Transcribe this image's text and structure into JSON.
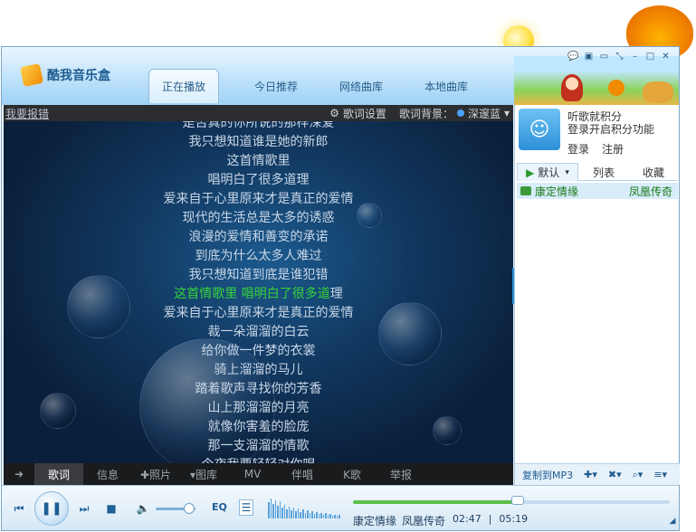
{
  "app": {
    "title": "酷我音乐盒"
  },
  "header": {
    "tabs": [
      {
        "label": "正在播放",
        "active": true
      },
      {
        "label": "今日推荐",
        "active": false
      },
      {
        "label": "网络曲库",
        "active": false
      },
      {
        "label": "本地曲库",
        "active": false
      }
    ]
  },
  "lyrics": {
    "report_link": "我要报错",
    "settings_label": "歌词设置",
    "background_label": "歌词背景：",
    "background_value": "深邃蓝",
    "lines": [
      "是否真的你所说的那样深爱",
      "我只想知道谁是她的新郎",
      "这首情歌里",
      "唱明白了很多道理",
      "爱来自于心里原来才是真正的爱情",
      "现代的生活总是太多的诱惑",
      "浪漫的爱情和善变的承诺",
      "到底为什么太多人难过",
      "我只想知道到底是谁犯错",
      "这首情歌里 唱明白了很多道理",
      "爱来自于心里原来才是真正的爱情",
      "裁一朵溜溜的白云",
      "给你做一件梦的衣裳",
      "骑上溜溜的马儿",
      "踏着歌声寻找你的芳香",
      "山上那溜溜的月亮",
      "就像你害羞的脸庞",
      "那一支溜溜的情歌",
      "今夜我要轻轻对你唱"
    ],
    "current_line_index": 9,
    "current_sung": "这首情歌里 唱明白了很多道",
    "current_rest": "理",
    "bottom_tabs": [
      "➜",
      "歌词",
      "信息",
      "✚照片",
      "▾图库",
      "MV",
      "伴唱",
      "K歌",
      "举报"
    ]
  },
  "right": {
    "user_line1": "听歌就积分",
    "user_line2": "登录开启积分功能",
    "login": "登录",
    "register": "注册",
    "list_tabs": [
      "默认",
      "列表",
      "收藏"
    ],
    "song": {
      "title": "康定情缘",
      "artist": "凤凰传奇"
    },
    "copy_mp3": "复制到MP3"
  },
  "player": {
    "eq_label": "EQ",
    "now_title": "康定情缘",
    "now_artist": "凤凰传奇",
    "elapsed": "02:47",
    "separator": "|",
    "duration": "05:19",
    "progress_fraction": 0.52,
    "volume_fraction": 0.85
  },
  "colors": {
    "accent": "#2d8fd8",
    "current_lyric": "#36d23a",
    "lyric_bg": "#0d2038"
  }
}
